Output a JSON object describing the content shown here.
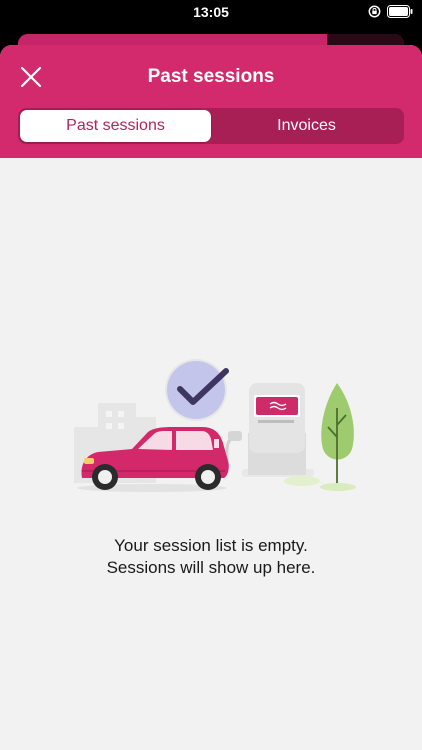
{
  "status_bar": {
    "time": "13:05"
  },
  "header": {
    "title": "Past sessions"
  },
  "tabs": [
    {
      "label": "Past sessions",
      "active": true
    },
    {
      "label": "Invoices",
      "active": false
    }
  ],
  "empty_state": {
    "line1": "Your session list is empty.",
    "line2": "Sessions will show up here."
  },
  "colors": {
    "brand": "#d22a6c",
    "tab_track": "#a81f56",
    "accent_text": "#b5235e",
    "background": "#f2f2f2"
  }
}
